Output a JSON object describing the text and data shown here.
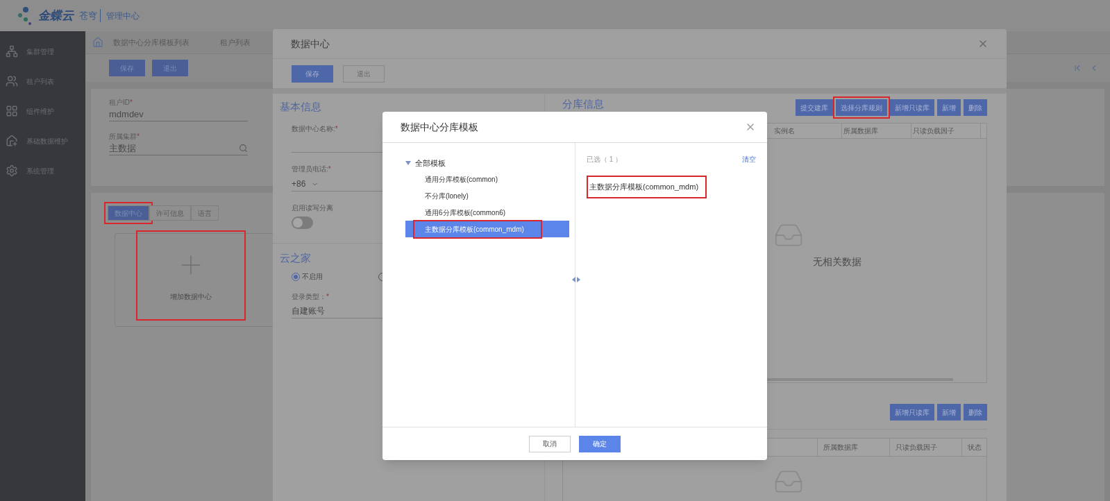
{
  "header": {
    "brand": "金蝶云",
    "product": "苍穹",
    "section": "管理中心"
  },
  "sidebar": {
    "items": [
      {
        "label": "集群管理"
      },
      {
        "label": "租户列表"
      },
      {
        "label": "组件维护"
      },
      {
        "label": "基础数据维护"
      },
      {
        "label": "系统管理"
      }
    ]
  },
  "breadcrumb": [
    "数据中心分库模板列表",
    "租户列表"
  ],
  "toolbar": [
    "保存",
    "退出"
  ],
  "form": [
    {
      "label": "租户ID",
      "required_mark": "*",
      "value": "mdmdev",
      "kind": "text"
    },
    {
      "label": "所属集群",
      "required_mark": "*",
      "value": "主数据",
      "kind": "lookup"
    }
  ],
  "tabs": [
    {
      "label": "数据中心",
      "selected": true,
      "annotated": true
    },
    {
      "label": "许可信息",
      "selected": false,
      "annotated": false
    },
    {
      "label": "语言",
      "selected": false,
      "annotated": false
    }
  ],
  "add_card": {
    "label": "增加数据中心",
    "annotated": true
  },
  "dialog": {
    "title": "数据中心",
    "toolbar": [
      {
        "label": "保存",
        "kind": "primary"
      },
      {
        "label": "退出",
        "kind": "default"
      }
    ],
    "basic": {
      "title": "基本信息",
      "fields": [
        {
          "label": "数据中心名称:",
          "required_mark": "*",
          "kind": "text"
        },
        {
          "label": "管理员电话:",
          "required_mark": "*",
          "kind": "phone",
          "value": "+86"
        },
        {
          "label": "启用读写分离",
          "kind": "toggle",
          "on": false
        }
      ]
    },
    "yunzhijia": {
      "title": "云之家",
      "radios": [
        {
          "label": "不启用",
          "selected": true
        },
        {
          "selected": false
        }
      ],
      "login_type": {
        "label": "登录类型：",
        "required_mark": "*",
        "value": "自建账号"
      }
    },
    "shards": {
      "title": "分库信息",
      "buttons": [
        {
          "label": "提交建库",
          "annotated": false
        },
        {
          "label": "选择分库规则",
          "annotated": true
        },
        {
          "label": "新增只读库",
          "annotated": false
        },
        {
          "label": "新增",
          "annotated": false
        },
        {
          "label": "删除",
          "annotated": false
        }
      ],
      "table": {
        "columns": [
          "实例名",
          "所属数据库",
          "只读负载因子"
        ],
        "empty_text": "无相关数据"
      },
      "buttons2": [
        "新增只读库",
        "新增",
        "删除"
      ],
      "table2": {
        "columns": [
          "所属数据库",
          "只读负载因子",
          "状态"
        ]
      }
    }
  },
  "picker": {
    "title": "数据中心分库模板",
    "tree": {
      "label": "全部模板",
      "expanded": true,
      "children": [
        {
          "label": "通用分库模板(common)",
          "selected": false,
          "annotated": false
        },
        {
          "label": "不分库(lonely)",
          "selected": false,
          "annotated": false
        },
        {
          "label": "通用6分库模板(common6)",
          "selected": false,
          "annotated": false
        },
        {
          "label": "主数据分库模板(common_mdm)",
          "selected": true,
          "annotated": true
        }
      ]
    },
    "selected_title": "已选（ 1 ）",
    "clear": "清空",
    "selected_items": [
      {
        "label": "主数据分库模板(common_mdm)",
        "annotated": true
      }
    ],
    "buttons": [
      {
        "label": "取消",
        "kind": "default"
      },
      {
        "label": "确定",
        "kind": "primary"
      }
    ]
  }
}
